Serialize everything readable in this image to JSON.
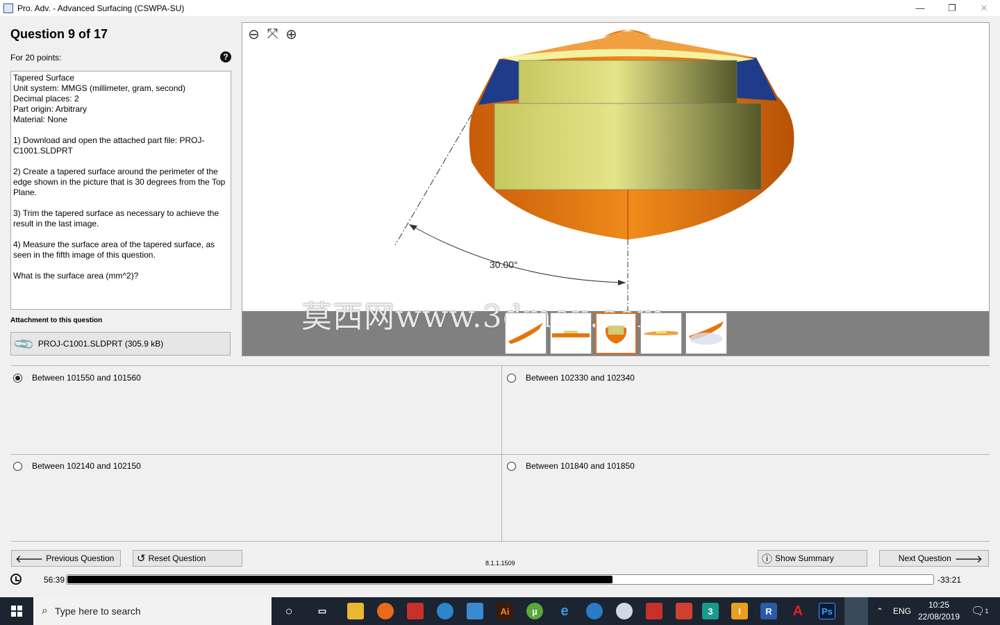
{
  "window": {
    "title": "Pro. Adv. - Advanced Surfacing (CSWPA-SU)",
    "minimize": "—",
    "restore": "❐",
    "close": "✕"
  },
  "question": {
    "title": "Question 9 of 17",
    "points": "For 20 points:",
    "help": "?",
    "text": [
      "Tapered Surface\nUnit system: MMGS (millimeter, gram, second)\nDecimal places: 2\nPart origin: Arbitrary\nMaterial: None",
      "1) Download and open the attached part file: PROJ-C1001.SLDPRT",
      "2) Create a tapered surface around the perimeter of the edge shown in the picture that is 30 degrees from the Top Plane.",
      "3) Trim the tapered surface as necessary to achieve the result in the last image.",
      "4) Measure the surface area of the tapered surface, as seen in the fifth image of this question.",
      "What is the surface area (mm^2)?"
    ]
  },
  "attachment": {
    "label": "Attachment to this question",
    "file": "PROJ-C1001.SLDPRT (305.9 kB)"
  },
  "viewer": {
    "angle_label": "30.00°",
    "watermark": "莫西网www.3dmox.com",
    "thumbnails": [
      "thumb-1",
      "thumb-2",
      "thumb-3",
      "thumb-4",
      "thumb-5"
    ],
    "active_thumbnail": 3
  },
  "answers": [
    {
      "label": "Between 101550 and 101560",
      "checked": true
    },
    {
      "label": "Between 102330 and 102340",
      "checked": false
    },
    {
      "label": "Between 102140 and 102150",
      "checked": false
    },
    {
      "label": "Between 101840 and 101850",
      "checked": false
    }
  ],
  "buttons": {
    "previous": "Previous Question",
    "reset": "Reset Question",
    "summary": "Show Summary",
    "next": "Next Question"
  },
  "version": "8.1.1.1509",
  "timer": {
    "elapsed": "56:39",
    "remaining": "-33:21",
    "progress": 0.63
  },
  "taskbar": {
    "search_placeholder": "Type here to search",
    "language": "ENG",
    "time": "10:25",
    "date": "22/08/2019",
    "notification_count": "1"
  },
  "colors": {
    "accent": "#e07020",
    "hull": "#e8740c",
    "deck": "#d8d870",
    "taskbar": "#1b2430"
  }
}
